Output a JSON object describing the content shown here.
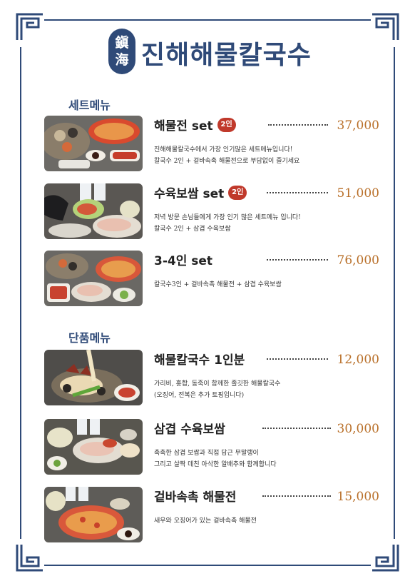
{
  "header": {
    "seal_top": "鎭",
    "seal_bottom": "海",
    "title": "진해해물칼국수"
  },
  "sections": {
    "set_title": "세트메뉴",
    "single_title": "단품메뉴"
  },
  "items": [
    {
      "name": "해물전 set",
      "badge": "2인",
      "price": "37,000",
      "desc1": "진해해물칼국수에서 가장 인기많은 세트메뉴입니다!",
      "desc2": "칼국수 2인 + 겉바속촉 해물전으로 부담없이 즐기세요"
    },
    {
      "name": "수육보쌈 set",
      "badge": "2인",
      "price": "51,000",
      "desc1": "저녁 방문 손님들에게 가장 인기 많은 세트메뉴 입니다!",
      "desc2": "칼국수 2인 + 삼겹 수육보쌈"
    },
    {
      "name": "3-4인 set",
      "badge": "",
      "price": "76,000",
      "desc1": "칼국수3인 + 겉바속촉 해물전 + 삼겹 수육보쌈",
      "desc2": ""
    },
    {
      "name": "해물칼국수 1인분",
      "badge": "",
      "price": "12,000",
      "desc1": "가리비, 홍합, 동죽이 함께한 졸깃한 해물칼국수",
      "desc2": "(오징어, 전복은 추가 토핑입니다)"
    },
    {
      "name": "삼겹 수육보쌈",
      "badge": "",
      "price": "30,000",
      "desc1": "촉촉한 삼겹 보쌈과 직접 담근 무말랭이",
      "desc2": "그리고 살짝 데친 아삭한 알배추와 함께합니다"
    },
    {
      "name": "겉바속촉 해물전",
      "badge": "",
      "price": "15,000",
      "desc1": "새우와 오징어가 있는 겉바속촉 해물전",
      "desc2": ""
    }
  ],
  "colors": {
    "brand_navy": "#2f4a78",
    "price_orange": "#b9702a",
    "badge_red": "#c0392b"
  },
  "icons": {
    "corner": "greek-key-corner-ornament"
  }
}
